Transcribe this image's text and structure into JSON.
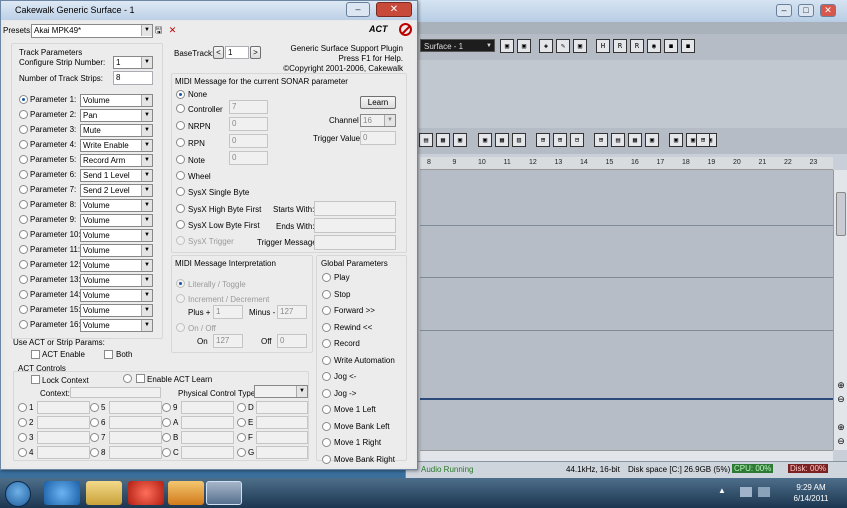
{
  "sonar": {
    "preset": "Surface - 1",
    "toolbar1": [
      "▣",
      "▣",
      "◈",
      "✎",
      "▣",
      "H",
      "R",
      "R",
      "◉",
      "◼",
      "◼"
    ],
    "toolbar2": [
      "▤",
      "▦",
      "▣",
      "▣",
      "▦",
      "▥",
      "⊞",
      "⊞",
      "⊟",
      "⊞",
      "▤",
      "▦",
      "▣",
      "▣",
      "▣",
      "▣",
      "⊞"
    ],
    "ruler": [
      "8",
      "9",
      "10",
      "11",
      "12",
      "13",
      "14",
      "15",
      "16",
      "17",
      "18",
      "19",
      "20",
      "21",
      "22",
      "23"
    ],
    "status": {
      "audio": "Audio Running",
      "format": "44.1kHz, 16-bit",
      "disk": "Disk space [C:] 26.9GB (5%)",
      "cpu": "CPU: 00%",
      "disk_meter": "Disk: 00%"
    }
  },
  "taskbar": {
    "time": "9:29 AM",
    "date": "6/14/2011"
  },
  "dialog": {
    "title": "Cakewalk Generic Surface - 1",
    "presets_label": "Presets:",
    "preset_value": "Akai MPK49*",
    "act_logo": "ACT",
    "track_params": {
      "heading": "Track Parameters",
      "configure_label": "Configure Strip Number:",
      "configure_value": "1",
      "strips_label": "Number of Track Strips:",
      "strips_value": "8"
    },
    "parameters": [
      {
        "label": "Parameter 1:",
        "value": "Volume"
      },
      {
        "label": "Parameter 2:",
        "value": "Pan"
      },
      {
        "label": "Parameter 3:",
        "value": "Mute"
      },
      {
        "label": "Parameter 4:",
        "value": "Write Enable"
      },
      {
        "label": "Parameter 5:",
        "value": "Record Arm"
      },
      {
        "label": "Parameter 6:",
        "value": "Send 1 Level"
      },
      {
        "label": "Parameter 7:",
        "value": "Send 2 Level"
      },
      {
        "label": "Parameter 8:",
        "value": "Volume"
      },
      {
        "label": "Parameter 9:",
        "value": "Volume"
      },
      {
        "label": "Parameter 10:",
        "value": "Volume"
      },
      {
        "label": "Parameter 11:",
        "value": "Volume"
      },
      {
        "label": "Parameter 12:",
        "value": "Volume"
      },
      {
        "label": "Parameter 13:",
        "value": "Volume"
      },
      {
        "label": "Parameter 14:",
        "value": "Volume"
      },
      {
        "label": "Parameter 15:",
        "value": "Volume"
      },
      {
        "label": "Parameter 16:",
        "value": "Volume"
      }
    ],
    "act_strip": {
      "heading": "Use ACT or Strip Params:",
      "act_enable": "ACT Enable",
      "both": "Both"
    },
    "act_controls": {
      "heading": "ACT Controls",
      "lock_context": "Lock Context",
      "enable_learn": "Enable ACT Learn",
      "context_label": "Context:",
      "physical_type_label": "Physical Control Type:",
      "grid": [
        [
          "1",
          "5",
          "9",
          "D"
        ],
        [
          "2",
          "6",
          "A",
          "E"
        ],
        [
          "3",
          "7",
          "B",
          "F"
        ],
        [
          "4",
          "8",
          "C",
          "G"
        ]
      ]
    },
    "basetrack": {
      "label": "BaseTrack:",
      "value": "1",
      "prev": "<",
      "next": ">"
    },
    "support": {
      "line1": "Generic Surface Support Plugin",
      "line2": "Press F1 for Help.",
      "line3": "©Copyright 2001-2006, Cakewalk"
    },
    "midi": {
      "heading": "MIDI Message for the current SONAR parameter",
      "learn": "Learn",
      "none": "None",
      "controller": "Controller",
      "controller_value": "7",
      "nrpn": "NRPN",
      "nrpn_value": "0",
      "rpn": "RPN",
      "rpn_value": "0",
      "note": "Note",
      "note_value": "0",
      "wheel": "Wheel",
      "channel_label": "Channel",
      "channel_value": "16",
      "trigger_label": "Trigger Value",
      "trigger_value": "0",
      "sysx_single": "SysX Single Byte",
      "sysx_high": "SysX High Byte First",
      "sysx_low": "SysX Low Byte First",
      "sysx_trigger": "SysX Trigger",
      "starts_with": "Starts With:",
      "ends_with": "Ends With:",
      "trigger_message": "Trigger Message:"
    },
    "interp": {
      "heading": "MIDI Message Interpretation",
      "literal": "Literally / Toggle",
      "incdec": "Increment / Decrement",
      "plus": "Plus +",
      "plus_value": "1",
      "minus": "Minus -",
      "minus_value": "127",
      "onoff": "On / Off",
      "on": "On",
      "on_value": "127",
      "off": "Off",
      "off_value": "0"
    },
    "global": {
      "heading": "Global Parameters",
      "items": [
        "Play",
        "Stop",
        "Forward >>",
        "Rewind <<",
        "Record",
        "Write Automation",
        "Jog <-",
        "Jog ->",
        "Move 1 Left",
        "Move Bank Left",
        "Move 1 Right",
        "Move Bank Right"
      ]
    }
  }
}
